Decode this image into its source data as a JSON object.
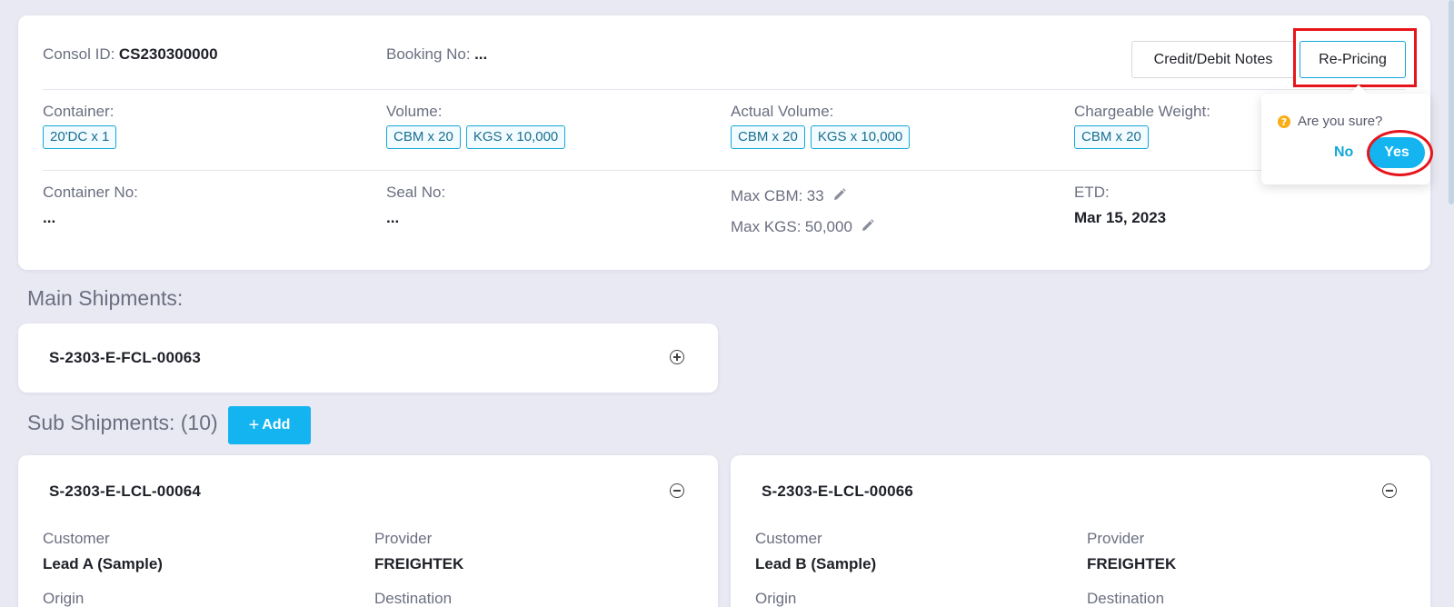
{
  "consol": {
    "consol_id_label": "Consol ID:",
    "consol_id_value": "CS230300000",
    "booking_no_label": "Booking No:",
    "booking_no_value": "...",
    "credit_debit_label": "Credit/Debit Notes",
    "repricing_label": "Re-Pricing",
    "container_label": "Container:",
    "container_tags": [
      "20'DC x 1"
    ],
    "volume_label": "Volume:",
    "volume_tags": [
      "CBM x 20",
      "KGS x 10,000"
    ],
    "actual_volume_label": "Actual Volume:",
    "actual_volume_tags": [
      "CBM x 20",
      "KGS x 10,000"
    ],
    "chargeable_weight_label": "Chargeable Weight:",
    "chargeable_weight_tags": [
      "CBM x 20"
    ],
    "container_no_label": "Container No:",
    "container_no_value": "...",
    "seal_no_label": "Seal No:",
    "seal_no_value": "...",
    "max_cbm_label": "Max CBM:",
    "max_cbm_value": "33",
    "max_kgs_label": "Max KGS:",
    "max_kgs_value": "50,000",
    "etd_label": "ETD:",
    "etd_value": "Mar 15, 2023"
  },
  "popconfirm": {
    "question": "Are you sure?",
    "no_label": "No",
    "yes_label": "Yes"
  },
  "main_shipments": {
    "title": "Main Shipments:",
    "items": [
      {
        "id": "S-2303-E-FCL-00063"
      }
    ]
  },
  "sub_shipments": {
    "title": "Sub Shipments: (10)",
    "add_label": "Add",
    "items": [
      {
        "id": "S-2303-E-LCL-00064",
        "customer_label": "Customer",
        "customer_value": "Lead A (Sample)",
        "provider_label": "Provider",
        "provider_value": "FREIGHTEK",
        "origin_label": "Origin",
        "destination_label": "Destination"
      },
      {
        "id": "S-2303-E-LCL-00066",
        "customer_label": "Customer",
        "customer_value": "Lead B (Sample)",
        "provider_label": "Provider",
        "provider_value": "FREIGHTEK",
        "origin_label": "Origin",
        "destination_label": "Destination"
      }
    ]
  },
  "colors": {
    "accent": "#13b4ef",
    "highlight_red": "#e8141b",
    "warning": "#faad14",
    "background": "#e9e9f3"
  }
}
